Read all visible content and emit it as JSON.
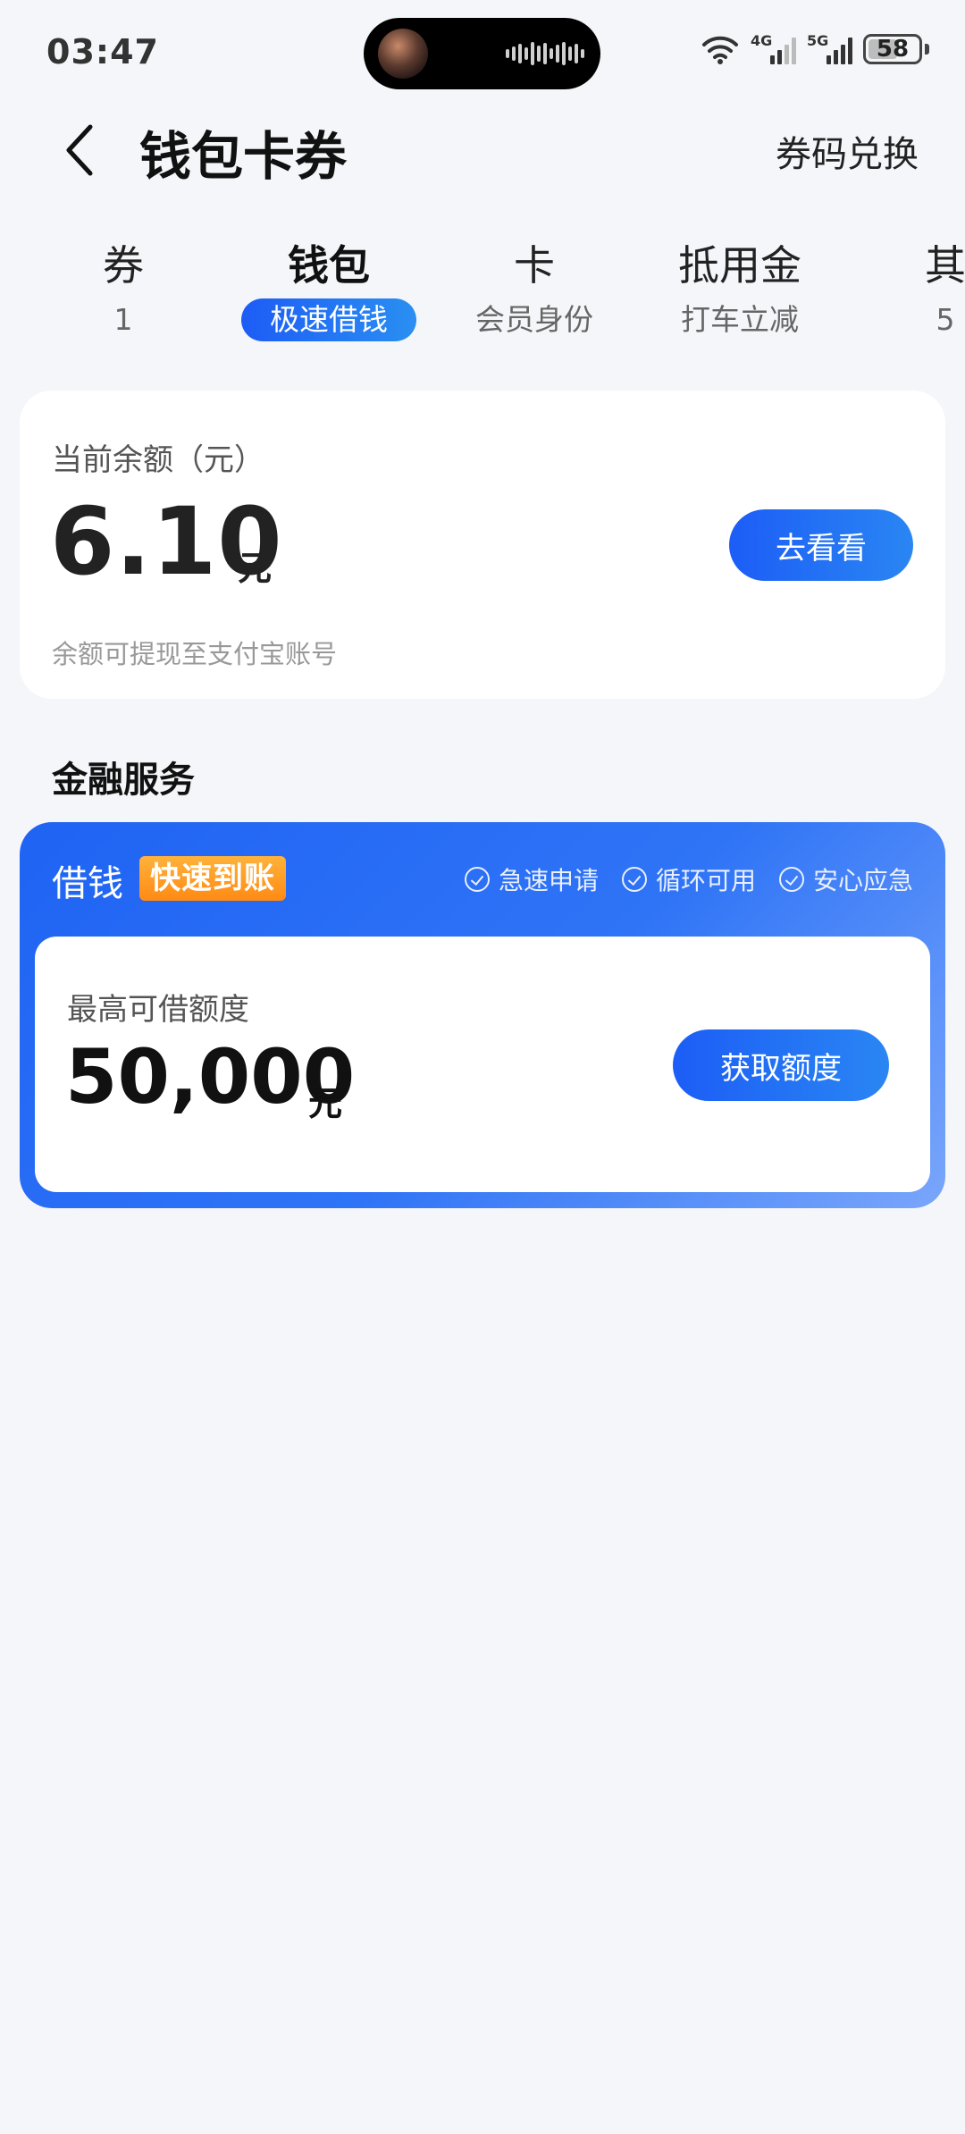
{
  "status_bar": {
    "time": "03:47",
    "signal1_label": "4G",
    "signal2_label": "5G",
    "battery": "58"
  },
  "header": {
    "title": "钱包卡券",
    "redeem_label": "券码兑换"
  },
  "tabs": [
    {
      "title": "券",
      "sub": "1"
    },
    {
      "title": "钱包",
      "sub": "极速借钱",
      "active": true
    },
    {
      "title": "卡",
      "sub": "会员身份"
    },
    {
      "title": "抵用金",
      "sub": "打车立减"
    },
    {
      "title": "其",
      "sub": "5"
    }
  ],
  "balance": {
    "label": "当前余额（元）",
    "amount": "6.10",
    "unit": "元",
    "note": "余额可提现至支付宝账号",
    "button_label": "去看看"
  },
  "finance": {
    "section_title": "金融服务",
    "card_title": "借钱",
    "tag": "快速到账",
    "features": [
      "急速申请",
      "循环可用",
      "安心应急"
    ],
    "limit_label": "最高可借额度",
    "limit_amount": "50,000",
    "limit_unit": "元",
    "button_label": "获取额度"
  },
  "colors": {
    "accent": "#1c5df6",
    "tag": "#ff9a1f",
    "background": "#f4f6f9"
  }
}
